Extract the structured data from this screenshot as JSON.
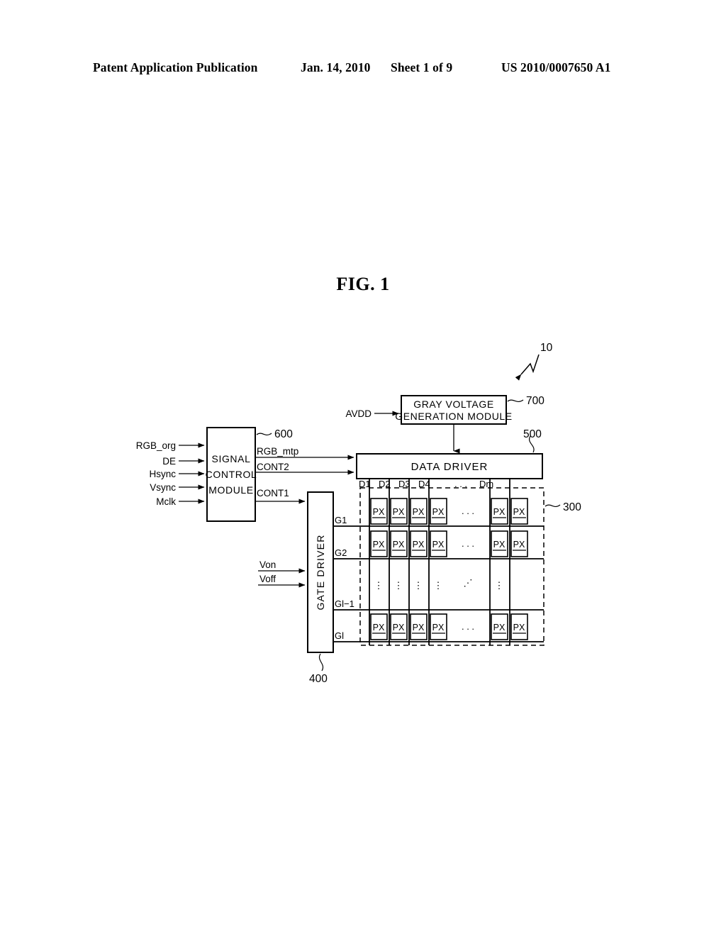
{
  "header": {
    "publication": "Patent Application Publication",
    "date": "Jan. 14, 2010",
    "sheet": "Sheet 1 of 9",
    "patent_number": "US 2010/0007650 A1"
  },
  "figure": {
    "title": "FIG. 1",
    "system_reference": "10"
  },
  "signal_control_module": {
    "label_line1": "SIGNAL",
    "label_line2": "CONTROL",
    "label_line3": "MODULE",
    "reference": "600",
    "inputs": [
      {
        "name": "RGB_org"
      },
      {
        "name": "DE"
      },
      {
        "name": "Hsync"
      },
      {
        "name": "Vsync"
      },
      {
        "name": "Mclk"
      }
    ],
    "outputs": [
      {
        "name": "RGB_mtp"
      },
      {
        "name": "CONT2"
      },
      {
        "name": "CONT1"
      }
    ]
  },
  "gray_voltage_module": {
    "label_line1": "GRAY VOLTAGE",
    "label_line2": "GENERATION MODULE",
    "reference": "700",
    "input": "AVDD"
  },
  "data_driver": {
    "label": "DATA DRIVER",
    "reference": "500",
    "data_lines": [
      "D1",
      "D2",
      "D3",
      "D4",
      "Dm"
    ],
    "ellipsis": ". . ."
  },
  "gate_driver": {
    "label": "GATE DRIVER",
    "reference": "400",
    "gate_lines": [
      "G1",
      "G2",
      "Gl−1",
      "Gl"
    ],
    "inputs": [
      {
        "name": "Von"
      },
      {
        "name": "Voff"
      }
    ]
  },
  "display_panel": {
    "reference": "300",
    "pixel_label": "PX",
    "row_ellipsis": ". . .",
    "column_ellipsis": "⋮",
    "diagonal_ellipsis": "⋰"
  }
}
